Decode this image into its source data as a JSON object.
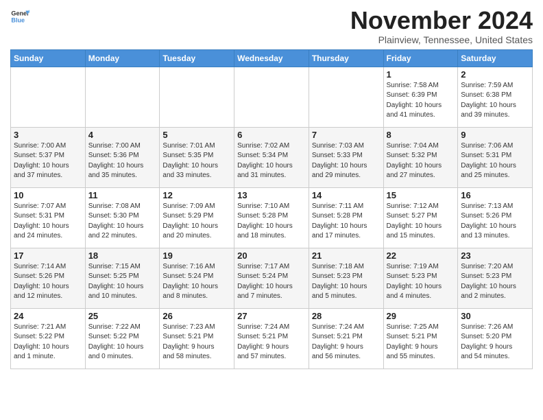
{
  "header": {
    "logo_general": "General",
    "logo_blue": "Blue",
    "month_year": "November 2024",
    "location": "Plainview, Tennessee, United States"
  },
  "days_of_week": [
    "Sunday",
    "Monday",
    "Tuesday",
    "Wednesday",
    "Thursday",
    "Friday",
    "Saturday"
  ],
  "weeks": [
    [
      {
        "day": "",
        "info": ""
      },
      {
        "day": "",
        "info": ""
      },
      {
        "day": "",
        "info": ""
      },
      {
        "day": "",
        "info": ""
      },
      {
        "day": "",
        "info": ""
      },
      {
        "day": "1",
        "info": "Sunrise: 7:58 AM\nSunset: 6:39 PM\nDaylight: 10 hours\nand 41 minutes."
      },
      {
        "day": "2",
        "info": "Sunrise: 7:59 AM\nSunset: 6:38 PM\nDaylight: 10 hours\nand 39 minutes."
      }
    ],
    [
      {
        "day": "3",
        "info": "Sunrise: 7:00 AM\nSunset: 5:37 PM\nDaylight: 10 hours\nand 37 minutes."
      },
      {
        "day": "4",
        "info": "Sunrise: 7:00 AM\nSunset: 5:36 PM\nDaylight: 10 hours\nand 35 minutes."
      },
      {
        "day": "5",
        "info": "Sunrise: 7:01 AM\nSunset: 5:35 PM\nDaylight: 10 hours\nand 33 minutes."
      },
      {
        "day": "6",
        "info": "Sunrise: 7:02 AM\nSunset: 5:34 PM\nDaylight: 10 hours\nand 31 minutes."
      },
      {
        "day": "7",
        "info": "Sunrise: 7:03 AM\nSunset: 5:33 PM\nDaylight: 10 hours\nand 29 minutes."
      },
      {
        "day": "8",
        "info": "Sunrise: 7:04 AM\nSunset: 5:32 PM\nDaylight: 10 hours\nand 27 minutes."
      },
      {
        "day": "9",
        "info": "Sunrise: 7:06 AM\nSunset: 5:31 PM\nDaylight: 10 hours\nand 25 minutes."
      }
    ],
    [
      {
        "day": "10",
        "info": "Sunrise: 7:07 AM\nSunset: 5:31 PM\nDaylight: 10 hours\nand 24 minutes."
      },
      {
        "day": "11",
        "info": "Sunrise: 7:08 AM\nSunset: 5:30 PM\nDaylight: 10 hours\nand 22 minutes."
      },
      {
        "day": "12",
        "info": "Sunrise: 7:09 AM\nSunset: 5:29 PM\nDaylight: 10 hours\nand 20 minutes."
      },
      {
        "day": "13",
        "info": "Sunrise: 7:10 AM\nSunset: 5:28 PM\nDaylight: 10 hours\nand 18 minutes."
      },
      {
        "day": "14",
        "info": "Sunrise: 7:11 AM\nSunset: 5:28 PM\nDaylight: 10 hours\nand 17 minutes."
      },
      {
        "day": "15",
        "info": "Sunrise: 7:12 AM\nSunset: 5:27 PM\nDaylight: 10 hours\nand 15 minutes."
      },
      {
        "day": "16",
        "info": "Sunrise: 7:13 AM\nSunset: 5:26 PM\nDaylight: 10 hours\nand 13 minutes."
      }
    ],
    [
      {
        "day": "17",
        "info": "Sunrise: 7:14 AM\nSunset: 5:26 PM\nDaylight: 10 hours\nand 12 minutes."
      },
      {
        "day": "18",
        "info": "Sunrise: 7:15 AM\nSunset: 5:25 PM\nDaylight: 10 hours\nand 10 minutes."
      },
      {
        "day": "19",
        "info": "Sunrise: 7:16 AM\nSunset: 5:24 PM\nDaylight: 10 hours\nand 8 minutes."
      },
      {
        "day": "20",
        "info": "Sunrise: 7:17 AM\nSunset: 5:24 PM\nDaylight: 10 hours\nand 7 minutes."
      },
      {
        "day": "21",
        "info": "Sunrise: 7:18 AM\nSunset: 5:23 PM\nDaylight: 10 hours\nand 5 minutes."
      },
      {
        "day": "22",
        "info": "Sunrise: 7:19 AM\nSunset: 5:23 PM\nDaylight: 10 hours\nand 4 minutes."
      },
      {
        "day": "23",
        "info": "Sunrise: 7:20 AM\nSunset: 5:23 PM\nDaylight: 10 hours\nand 2 minutes."
      }
    ],
    [
      {
        "day": "24",
        "info": "Sunrise: 7:21 AM\nSunset: 5:22 PM\nDaylight: 10 hours\nand 1 minute."
      },
      {
        "day": "25",
        "info": "Sunrise: 7:22 AM\nSunset: 5:22 PM\nDaylight: 10 hours\nand 0 minutes."
      },
      {
        "day": "26",
        "info": "Sunrise: 7:23 AM\nSunset: 5:21 PM\nDaylight: 9 hours\nand 58 minutes."
      },
      {
        "day": "27",
        "info": "Sunrise: 7:24 AM\nSunset: 5:21 PM\nDaylight: 9 hours\nand 57 minutes."
      },
      {
        "day": "28",
        "info": "Sunrise: 7:24 AM\nSunset: 5:21 PM\nDaylight: 9 hours\nand 56 minutes."
      },
      {
        "day": "29",
        "info": "Sunrise: 7:25 AM\nSunset: 5:21 PM\nDaylight: 9 hours\nand 55 minutes."
      },
      {
        "day": "30",
        "info": "Sunrise: 7:26 AM\nSunset: 5:20 PM\nDaylight: 9 hours\nand 54 minutes."
      }
    ]
  ]
}
